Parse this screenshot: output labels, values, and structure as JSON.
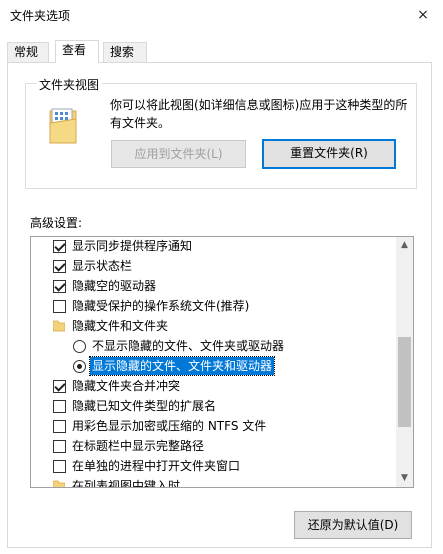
{
  "window": {
    "title": "文件夹选项",
    "close_glyph": "×"
  },
  "tabs": [
    {
      "label": "常规",
      "active": false
    },
    {
      "label": "查看",
      "active": true
    },
    {
      "label": "搜索",
      "active": false
    }
  ],
  "folder_views": {
    "group_title": "文件夹视图",
    "description": "你可以将此视图(如详细信息或图标)应用于这种类型的所有文件夹。",
    "apply_button": "应用到文件夹(L)",
    "reset_button": "重置文件夹(R)"
  },
  "advanced": {
    "label": "高级设置:",
    "items": [
      {
        "kind": "checkbox",
        "checked": true,
        "label": "显示同步提供程序通知"
      },
      {
        "kind": "checkbox",
        "checked": true,
        "label": "显示状态栏"
      },
      {
        "kind": "checkbox",
        "checked": true,
        "label": "隐藏空的驱动器"
      },
      {
        "kind": "checkbox",
        "checked": false,
        "label": "隐藏受保护的操作系统文件(推荐)"
      },
      {
        "kind": "folder",
        "label": "隐藏文件和文件夹"
      },
      {
        "kind": "radio",
        "checked": false,
        "label": "不显示隐藏的文件、文件夹或驱动器"
      },
      {
        "kind": "radio",
        "checked": true,
        "selected": true,
        "label": "显示隐藏的文件、文件夹和驱动器"
      },
      {
        "kind": "checkbox",
        "checked": true,
        "label": "隐藏文件夹合并冲突"
      },
      {
        "kind": "checkbox",
        "checked": false,
        "label": "隐藏已知文件类型的扩展名"
      },
      {
        "kind": "checkbox",
        "checked": false,
        "label": "用彩色显示加密或压缩的 NTFS 文件"
      },
      {
        "kind": "checkbox",
        "checked": false,
        "label": "在标题栏中显示完整路径"
      },
      {
        "kind": "checkbox",
        "checked": false,
        "label": "在单独的进程中打开文件夹窗口"
      },
      {
        "kind": "folder",
        "label": "在列表视图中键入时"
      }
    ],
    "restore_button": "还原为默认值(D)"
  },
  "colors": {
    "selection": "#0078d7",
    "focus_border": "#0078d7"
  }
}
